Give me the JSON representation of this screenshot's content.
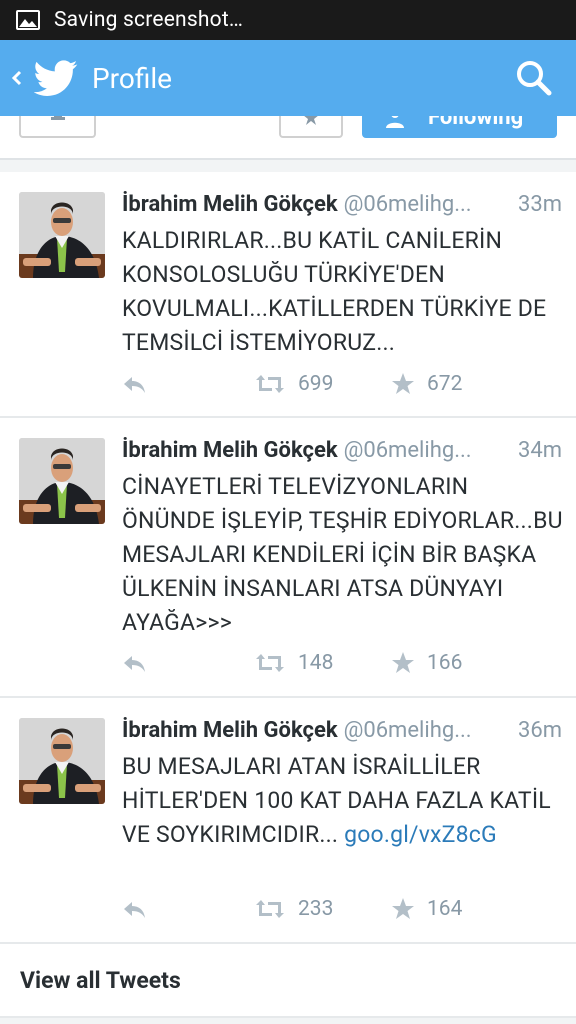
{
  "status_bar": {
    "text": "Saving screenshot…",
    "icon": "image-icon"
  },
  "action_bar": {
    "title": "Profile",
    "back_icon": "chevron-left-icon",
    "logo_icon": "twitter-bird-icon",
    "search_icon": "search-icon",
    "color": "#55acee"
  },
  "profile_strip": {
    "follow_label": "Following"
  },
  "tweets": [
    {
      "name": "İbrahim Melih Gökçek",
      "handle": "@06melihg...",
      "time": "33m",
      "text": "KALDIRIRLAR...BU KATİL CANİLERİN KONSOLOSLUĞU TÜRKİYE'DEN KOVULMALI...KATİLLERDEN TÜRKİYE DE TEMSİLCİ İSTEMİYORUZ...",
      "link": "",
      "retweets": "699",
      "favorites": "672"
    },
    {
      "name": "İbrahim Melih Gökçek",
      "handle": "@06melihg...",
      "time": "34m",
      "text": "CİNAYETLERİ TELEVİZYONLARIN ÖNÜNDE İŞLEYİP, TEŞHİR EDİYORLAR...BU MESAJLARI KENDİLERİ İÇİN BİR BAŞKA ÜLKENİN İNSANLARI ATSA DÜNYAYI AYAĞA>>>",
      "link": "",
      "retweets": "148",
      "favorites": "166"
    },
    {
      "name": "İbrahim Melih Gökçek",
      "handle": "@06melihg...",
      "time": "36m",
      "text": "BU MESAJLARI ATAN İSRAİLLİLER HİTLER'DEN 100 KAT DAHA FAZLA KATİL VE SOYKIRIMCIDIR... ",
      "link": "goo.gl/vxZ8cG",
      "retweets": "233",
      "favorites": "164"
    }
  ],
  "view_all": {
    "label": "View all Tweets"
  }
}
